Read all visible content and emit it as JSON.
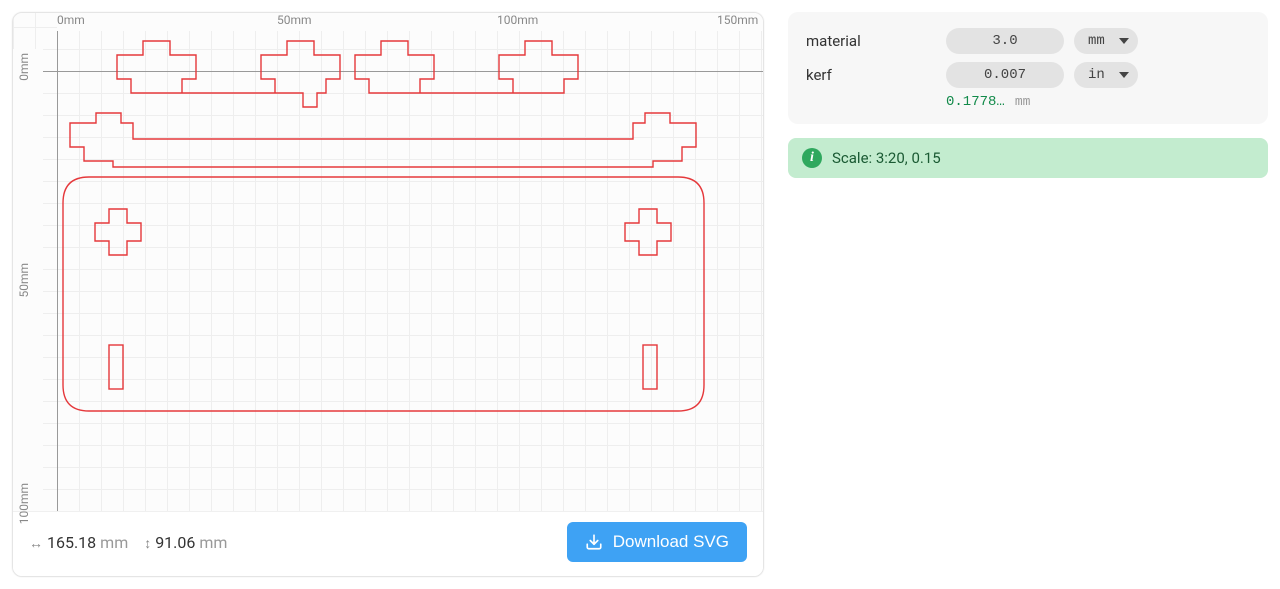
{
  "canvas": {
    "ruler_ticks_top": [
      "0mm",
      "50mm",
      "100mm",
      "150mm"
    ],
    "ruler_ticks_left": [
      "0mm",
      "50mm",
      "100mm"
    ],
    "width_value": "165.18",
    "width_unit": "mm",
    "height_value": "91.06",
    "height_unit": "mm",
    "download_label": "Download SVG"
  },
  "controls": {
    "material": {
      "label": "material",
      "value": "3.0",
      "unit": "mm"
    },
    "kerf": {
      "label": "kerf",
      "value": "0.007",
      "unit": "in",
      "converted_value": "0.1778…",
      "converted_unit": "mm"
    }
  },
  "info": {
    "text": "Scale: 3:20, 0.15"
  }
}
